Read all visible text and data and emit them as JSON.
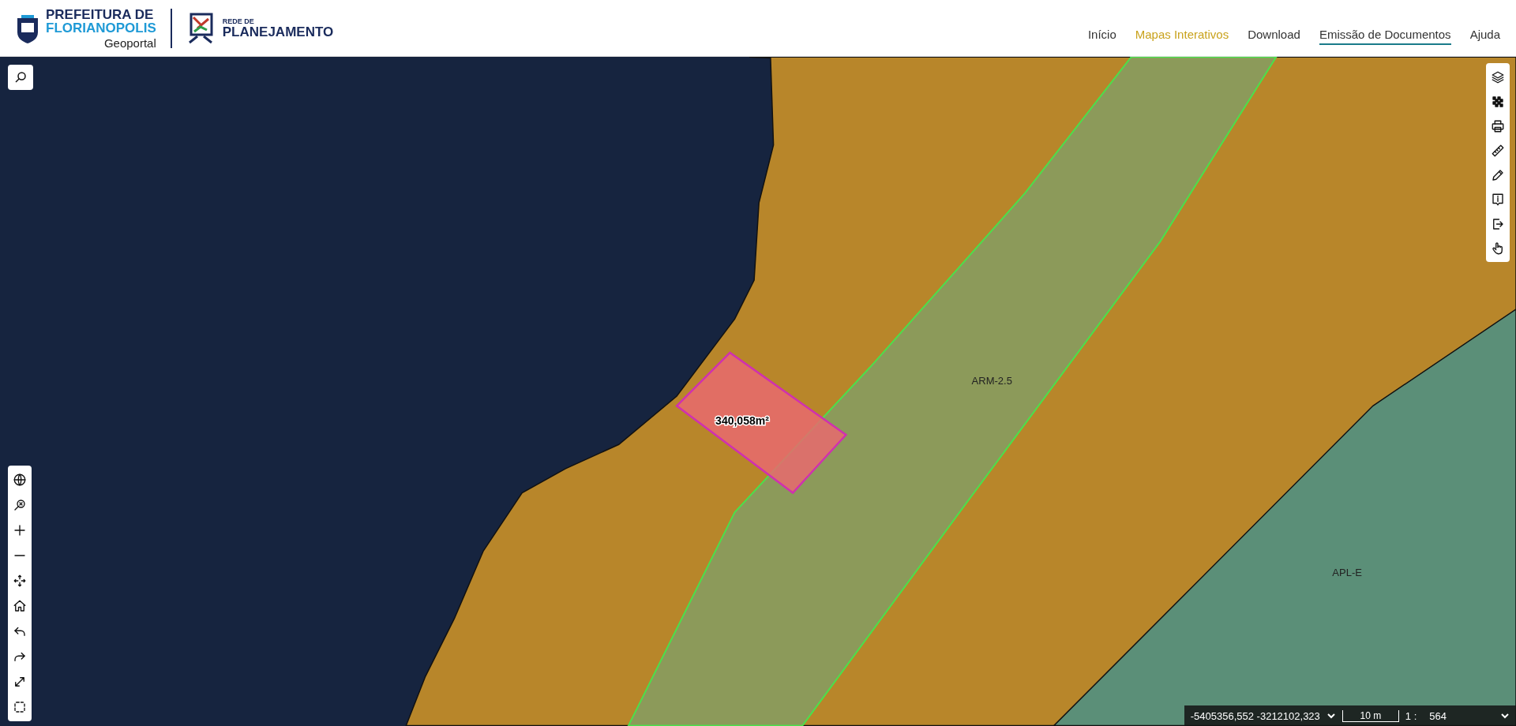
{
  "header": {
    "logo_top": "PREFEITURA DE",
    "logo_bottom": "FLORIANOPOLIS",
    "logo_sub": "Geoportal",
    "network_small": "REDE DE",
    "network_big": "PLANEJAMENTO"
  },
  "nav": [
    {
      "label": "Início",
      "highlighted": false,
      "selected": false
    },
    {
      "label": "Mapas Interativos",
      "highlighted": true,
      "selected": false
    },
    {
      "label": "Download",
      "highlighted": false,
      "selected": false
    },
    {
      "label": "Emissão de Documentos",
      "highlighted": false,
      "selected": true
    },
    {
      "label": "Ajuda",
      "highlighted": false,
      "selected": false
    }
  ],
  "map": {
    "zone_labels": [
      "ARM-2.5",
      "APL-E"
    ],
    "parcel_area": "340,058m²"
  },
  "status_bar": {
    "coordinates": "-5405356,552 -3212102,323",
    "scale_bar": "10 m",
    "scale_prefix": "1 :",
    "scale_value": "564"
  }
}
